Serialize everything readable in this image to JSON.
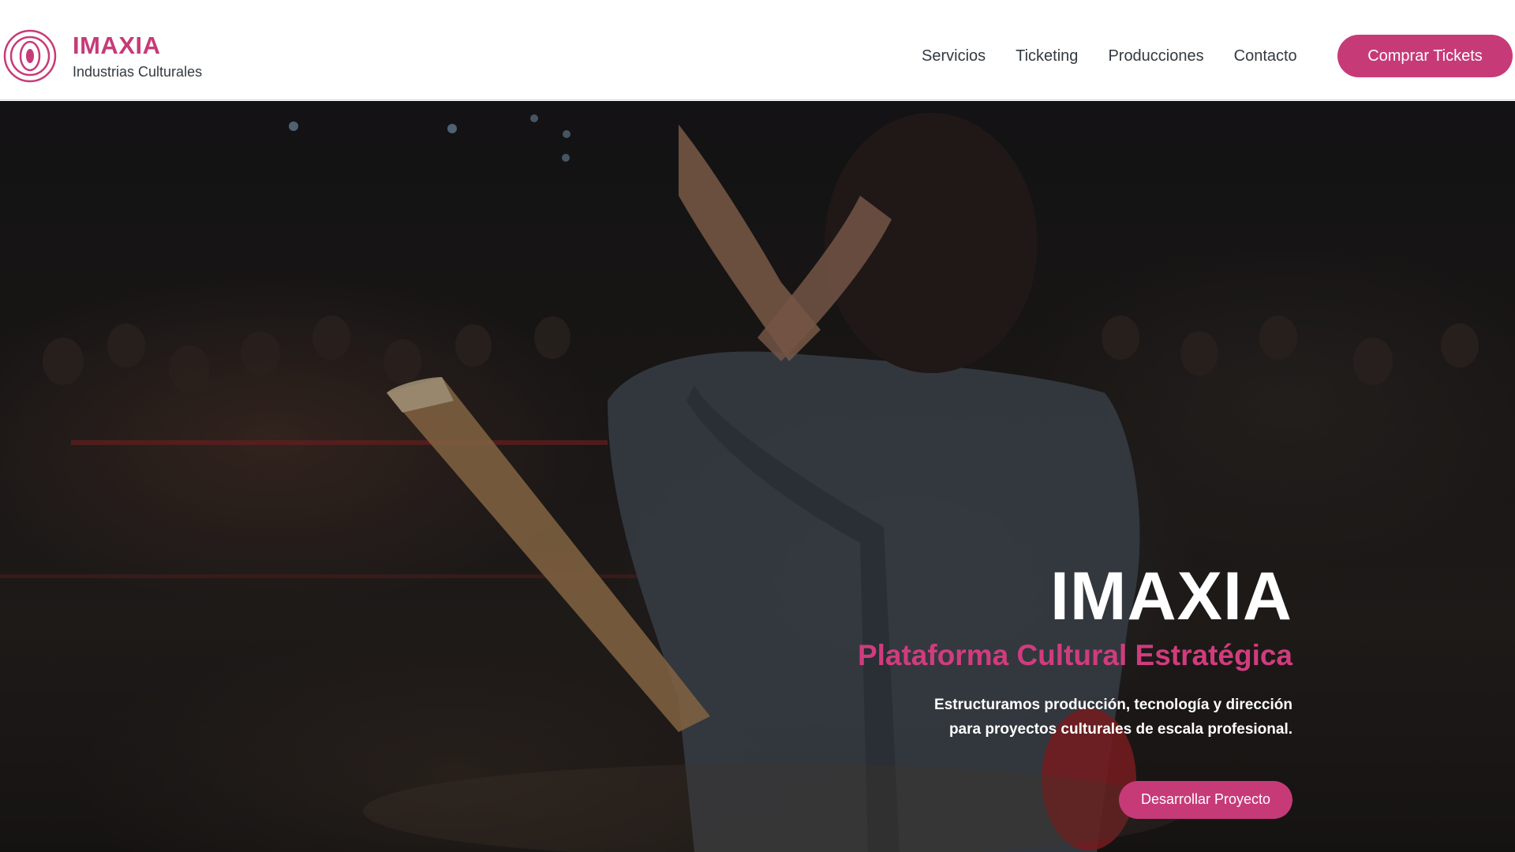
{
  "colors": {
    "accent": "#c73a78",
    "accent_text": "#d03c7d",
    "nav_text": "#333a40",
    "header_bg": "#ffffff"
  },
  "header": {
    "brand_name": "IMAXIA",
    "brand_tagline": "Industrias Culturales",
    "logo_icon": "concentric-circle-logo-icon",
    "nav": [
      {
        "label": "Servicios"
      },
      {
        "label": "Ticketing"
      },
      {
        "label": "Producciones"
      },
      {
        "label": "Contacto"
      }
    ],
    "cta_label": "Comprar Tickets"
  },
  "hero": {
    "title": "IMAXIA",
    "subtitle": "Plataforma Cultural Estratégica",
    "description_lines": [
      "Estructuramos producción, tecnología y dirección",
      "para proyectos culturales de escala profesional."
    ],
    "cta_label": "Desarrollar Proyecto"
  }
}
